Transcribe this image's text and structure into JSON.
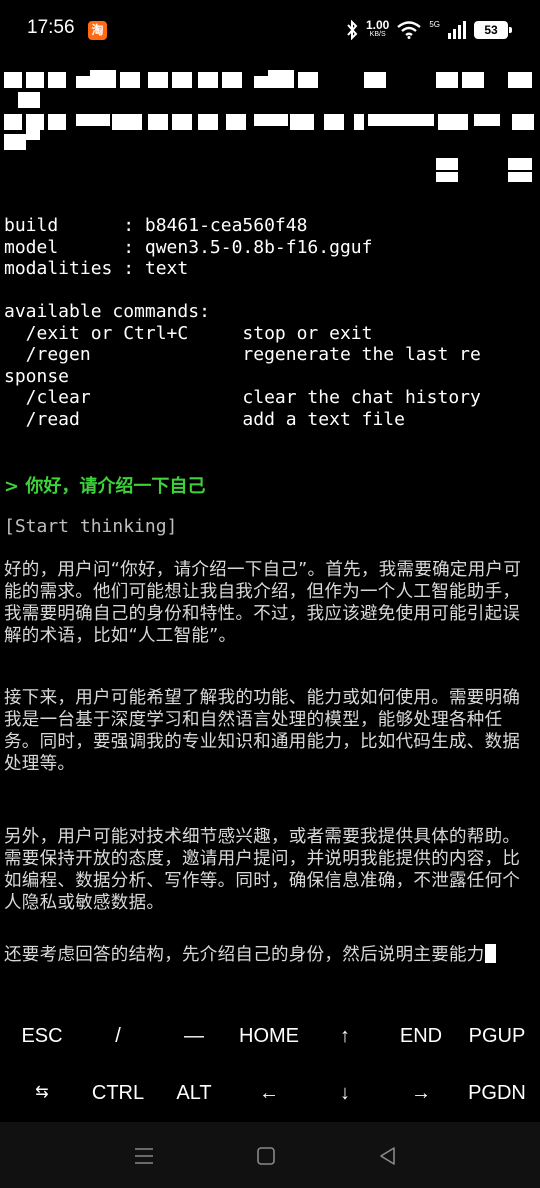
{
  "status_bar": {
    "time": "17:56",
    "app_icon": "taobao-icon",
    "app_icon_label": "淘",
    "net_speed_value": "1.00",
    "net_speed_unit": "KB/S",
    "network": "5G",
    "battery": "53",
    "icons": [
      "bluetooth-icon",
      "wifi-icon",
      "signal-icon",
      "battery-icon"
    ]
  },
  "terminal": {
    "info": {
      "build": "build      : b8461-cea560f48",
      "model": "model      : qwen3.5-0.8b-f16.gguf",
      "modalities": "modalities : text"
    },
    "commands_header": "available commands:",
    "commands": [
      "  /exit or Ctrl+C     stop or exit",
      "  /regen              regenerate the last re",
      "sponse",
      "  /clear              clear the chat history",
      "  /read               add a text file"
    ],
    "prompt": "> 你好，请介绍一下自己",
    "thinking_tag": "[Start thinking]",
    "paragraphs": [
      "好的，用户问“你好，请介绍一下自己”。首先，我需要确定用户可能的需求。他们可能想让我自我介绍，但作为一个人工智能助手，我需要明确自己的身份和特性。不过，我应该避免使用可能引起误解的术语，比如“人工智能”。",
      "接下来，用户可能希望了解我的功能、能力或如何使用。需要明确我是一台基于深度学习和自然语言处理的模型，能够处理各种任务。同时，要强调我的专业知识和通用能力，比如代码生成、数据处理等。",
      "另外，用户可能对技术细节感兴趣，或者需要我提供具体的帮助。需要保持开放的态度，邀请用户提问，并说明我能提供的内容，比如编程、数据分析、写作等。同时，确保信息准确，不泄露任何个人隐私或敏感数据。",
      "还要考虑回答的结构，先介绍自己的身份，然后说明主要能力"
    ]
  },
  "extra_keys": {
    "row1": [
      "ESC",
      "/",
      "—",
      "HOME",
      "↑",
      "END",
      "PGUP"
    ],
    "row2": [
      "⇆",
      "CTRL",
      "ALT",
      "←",
      "↓",
      "→",
      "PGDN"
    ]
  },
  "nav_bar": {
    "buttons": [
      "menu-icon",
      "home-icon",
      "back-icon"
    ]
  }
}
